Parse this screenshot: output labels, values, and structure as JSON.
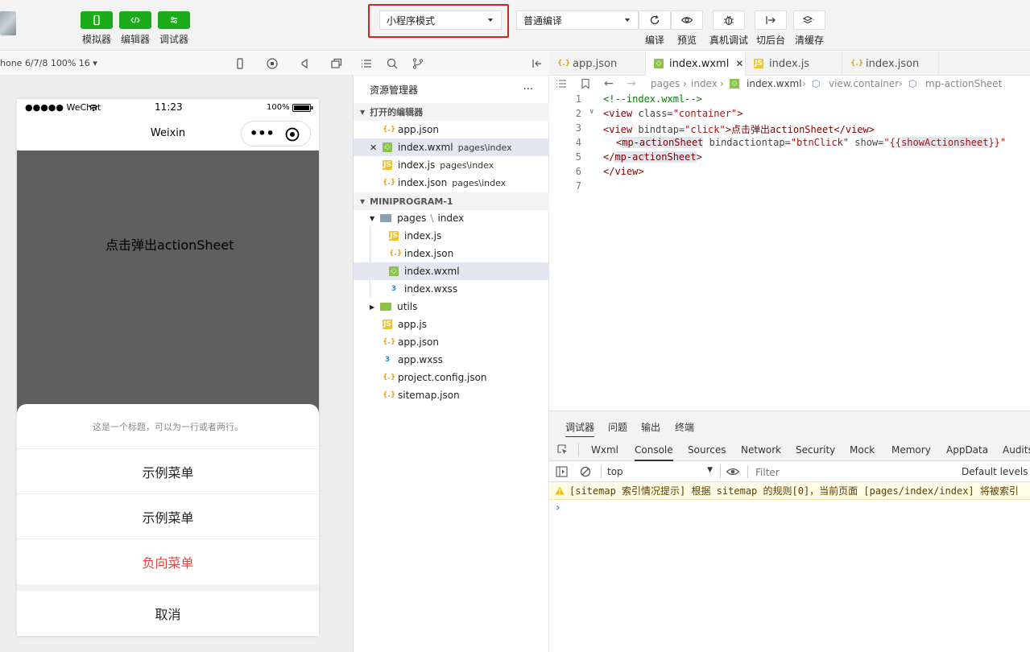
{
  "toolbar": {
    "buttons": [
      {
        "label": "模拟器",
        "icon": "phone-icon"
      },
      {
        "label": "编辑器",
        "icon": "code-icon"
      },
      {
        "label": "调试器",
        "icon": "debug-icon"
      }
    ],
    "mode_select": "小程序模式",
    "compile_select": "普通编译",
    "actions": [
      {
        "label": "编译",
        "icon": "refresh-icon"
      },
      {
        "label": "预览",
        "icon": "eye-icon"
      },
      {
        "label": "真机调试",
        "icon": "bug-icon"
      },
      {
        "label": "切后台",
        "icon": "switch-icon"
      },
      {
        "label": "清缓存",
        "icon": "layers-icon"
      }
    ]
  },
  "simulator": {
    "device": "hone 6/7/8 100% 16 ▾",
    "status_carrier": "●●●●● WeChat",
    "status_time": "11:23",
    "status_battery": "100%",
    "nav_title": "Weixin",
    "capsule_dots": "•••",
    "click_text": "点击弹出actionSheet",
    "sheet": {
      "title": "这是一个标题，可以为一行或者两行。",
      "items": [
        "示例菜单",
        "示例菜单",
        "负向菜单"
      ],
      "cancel": "取消",
      "warn_color": "#e64340"
    }
  },
  "explorer": {
    "title": "资源管理器",
    "more": "···",
    "open_editors_label": "打开的编辑器",
    "open_editors": [
      {
        "name": "app.json",
        "path": "",
        "type": "json"
      },
      {
        "name": "index.wxml",
        "path": "pages\\index",
        "type": "wxml",
        "close": "✕"
      },
      {
        "name": "index.js",
        "path": "pages\\index",
        "type": "js"
      },
      {
        "name": "index.json",
        "path": "pages\\index",
        "type": "json"
      }
    ],
    "project_label": "MINIPROGRAM-1",
    "tree": {
      "pages_folder": "pages",
      "pages_sep": "\\",
      "pages_sub": "index",
      "page_files": [
        {
          "name": "index.js",
          "type": "js"
        },
        {
          "name": "index.json",
          "type": "json"
        },
        {
          "name": "index.wxml",
          "type": "wxml"
        },
        {
          "name": "index.wxss",
          "type": "wxss"
        }
      ],
      "utils_folder": "utils",
      "root_files": [
        {
          "name": "app.js",
          "type": "js"
        },
        {
          "name": "app.json",
          "type": "json"
        },
        {
          "name": "app.wxss",
          "type": "wxss"
        },
        {
          "name": "project.config.json",
          "type": "json"
        },
        {
          "name": "sitemap.json",
          "type": "json"
        }
      ]
    }
  },
  "editor": {
    "tabs": [
      {
        "name": "app.json",
        "type": "json"
      },
      {
        "name": "index.wxml",
        "type": "wxml",
        "close": "✕"
      },
      {
        "name": "index.js",
        "type": "js"
      },
      {
        "name": "index.json",
        "type": "json"
      }
    ],
    "breadcrumb": [
      "pages",
      "index",
      "index.wxml",
      "view.container",
      "mp-actionSheet"
    ],
    "line_numbers": [
      "1",
      "2",
      "3",
      "4",
      "5",
      "6",
      "7"
    ],
    "code": {
      "l1": "<!--index.wxml-->",
      "l2a": "<view",
      "l2b": " class=",
      "l2c": "\"container\"",
      "l2d": ">",
      "l3a": "<view",
      "l3b": " bindtap=",
      "l3c": "\"click\"",
      "l3d": ">点击弹出actionSheet</view>",
      "l4a": "<",
      "l4b": "mp-",
      "l4c": "actionSheet",
      "l4d": " bindactiontap=",
      "l4e": "\"btnClick\"",
      "l4f": " show=",
      "l4g": "\"{{",
      "l4h": "showActionsheet",
      "l4i": "}}\"",
      "l5a": "</",
      "l5b": "mp-actionSheet",
      "l5c": ">",
      "l6": "</view>"
    }
  },
  "console": {
    "top_tabs": [
      "调试器",
      "问题",
      "输出",
      "终端"
    ],
    "devtools_tabs": [
      "Wxml",
      "Console",
      "Sources",
      "Network",
      "Security",
      "Mock",
      "Memory",
      "AppData",
      "Audits"
    ],
    "context": "top",
    "filter_placeholder": "Filter",
    "levels": "Default levels ▾",
    "message": "[sitemap 索引情况提示] 根据 sitemap 的规则[0]，当前页面 [pages/index/index] 将被索引",
    "prompt": "›"
  },
  "colors": {
    "green": "#1aad19",
    "red_highlight": "#e02020"
  }
}
